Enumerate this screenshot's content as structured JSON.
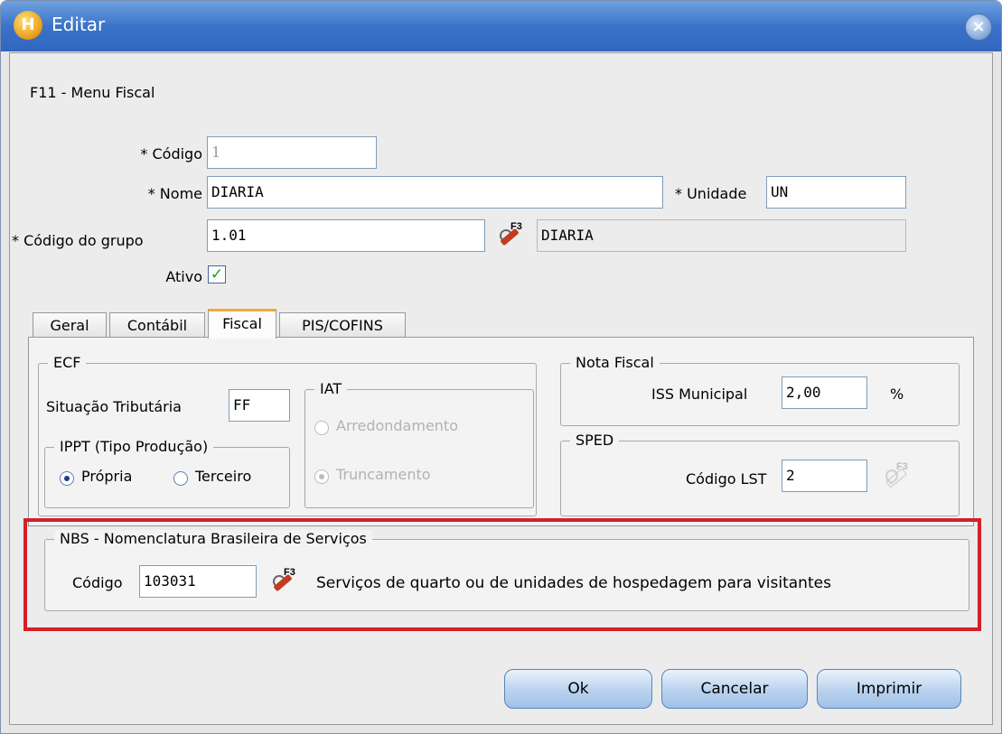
{
  "window": {
    "title": "Editar",
    "app_icon_glyph": "H",
    "close_glyph": "×"
  },
  "heading": "F11 - Menu Fiscal",
  "form": {
    "codigo": {
      "label": "* Código",
      "value": "1"
    },
    "nome": {
      "label": "* Nome",
      "value": "DIARIA"
    },
    "unidade": {
      "label": "* Unidade",
      "value": "UN"
    },
    "codigo_grupo": {
      "label": "* Código do grupo",
      "value": "1.01",
      "description": "DIARIA"
    },
    "ativo": {
      "label": "Ativo",
      "checked": true,
      "check_glyph": "✓"
    }
  },
  "lookup": {
    "f3_label": "F3"
  },
  "tabs": [
    {
      "label": "Geral",
      "active": false
    },
    {
      "label": "Contábil",
      "active": false
    },
    {
      "label": "Fiscal",
      "active": true
    },
    {
      "label": "PIS/COFINS",
      "active": false
    }
  ],
  "ecf": {
    "legend": "ECF",
    "situacao_label": "Situação Tributária",
    "situacao_value": "FF",
    "ippt": {
      "legend": "IPPT (Tipo Produção)",
      "options": [
        {
          "label": "Própria",
          "checked": true
        },
        {
          "label": "Terceiro",
          "checked": false
        }
      ]
    },
    "iat": {
      "legend": "IAT",
      "options": [
        {
          "label": "Arredondamento",
          "checked": false
        },
        {
          "label": "Truncamento",
          "checked": true
        }
      ]
    }
  },
  "nota_fiscal": {
    "legend": "Nota Fiscal",
    "iss_label": "ISS Municipal",
    "iss_value": "2,00",
    "percent": "%"
  },
  "sped": {
    "legend": "SPED",
    "lst_label": "Código LST",
    "lst_value": "2"
  },
  "nbs": {
    "legend": "NBS - Nomenclatura Brasileira de Serviços",
    "codigo_label": "Código",
    "codigo_value": "103031",
    "description": "Serviços de quarto ou de unidades de hospedagem para visitantes"
  },
  "highlight_color": "#d61f26",
  "buttons": {
    "ok": "Ok",
    "cancelar": "Cancelar",
    "imprimir": "Imprimir"
  }
}
